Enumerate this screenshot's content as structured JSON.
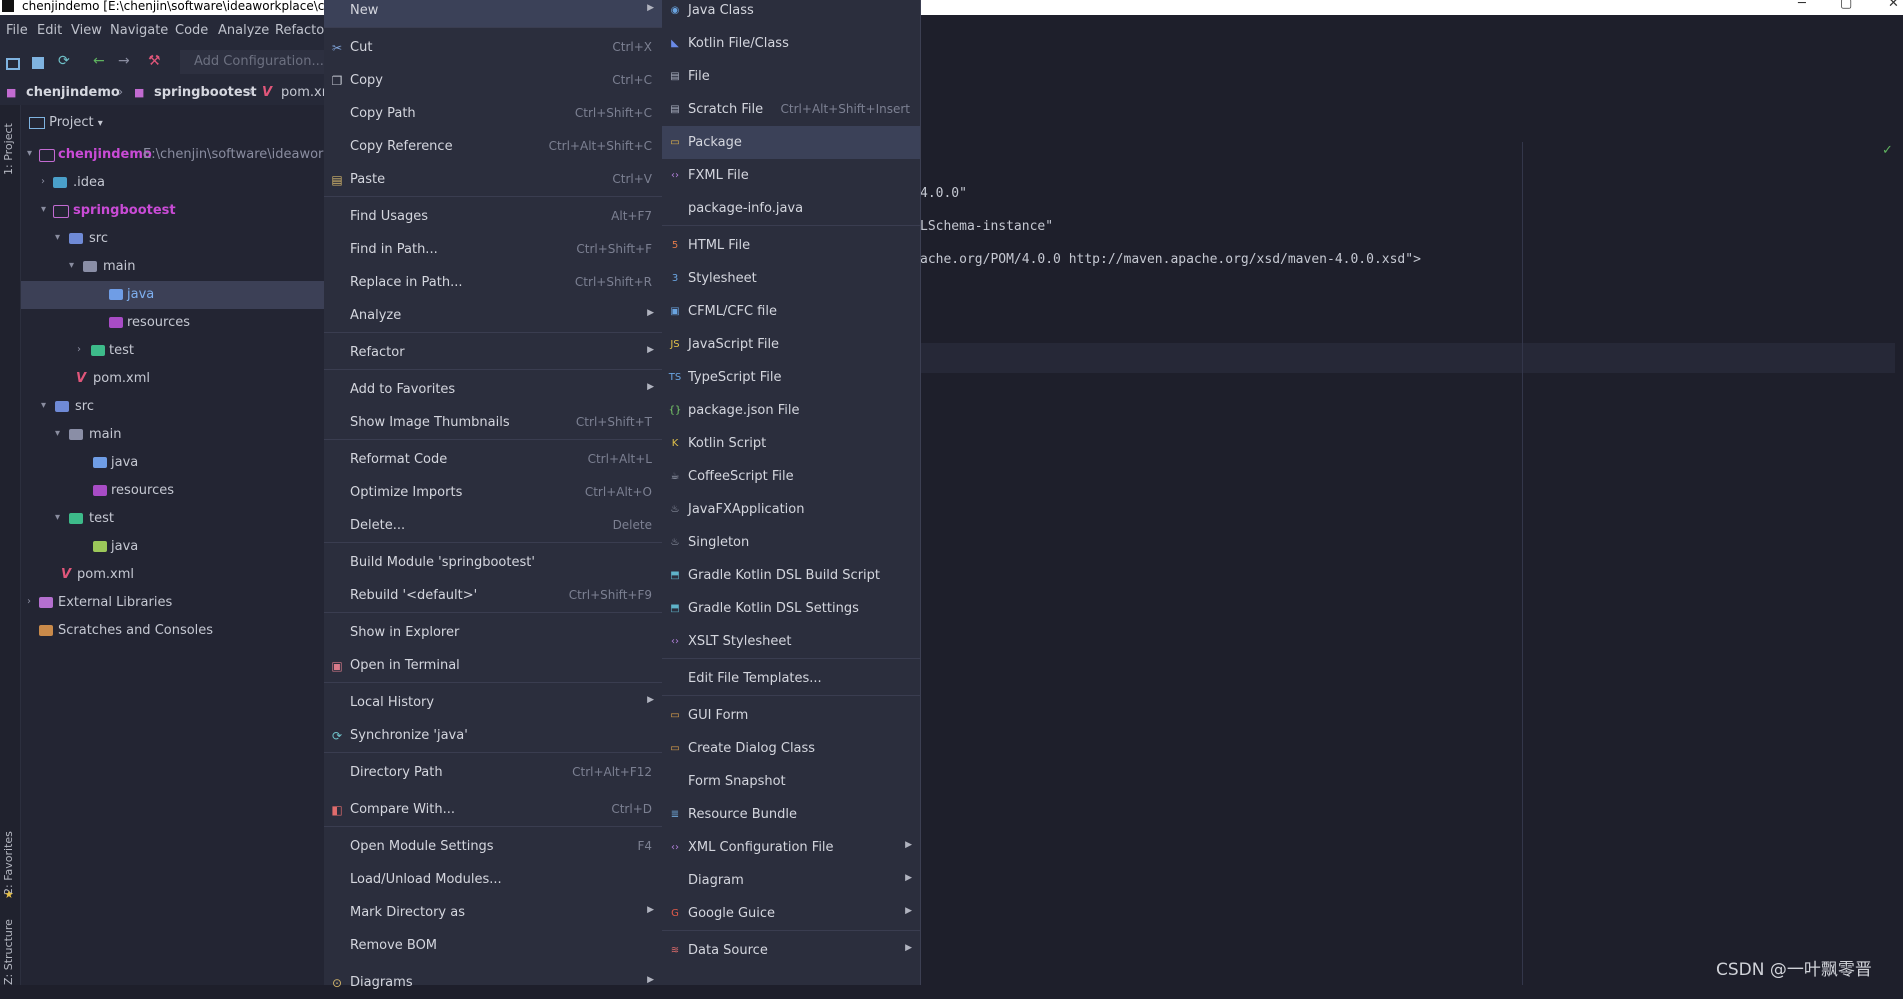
{
  "window": {
    "title": "chenjindemo [E:\\chenjin\\software\\ideaworkplace\\che"
  },
  "menubar": [
    "File",
    "Edit",
    "View",
    "Navigate",
    "Code",
    "Analyze",
    "Refactor"
  ],
  "toolbar": {
    "add_configuration": "Add Configuration..."
  },
  "breadcrumb": [
    "chenjindemo",
    "springbootest",
    "pom.xml"
  ],
  "left_strip": {
    "project_tab": "1: Project",
    "favorites_tab": "2: Favorites",
    "structure_tab": "Z: Structure"
  },
  "project_panel": {
    "header": "Project",
    "tree": [
      {
        "label": "chenjindemo",
        "path": "E:\\chenjin\\software\\ideaworkpl"
      },
      {
        "label": ".idea"
      },
      {
        "label": "springbootest"
      },
      {
        "label": "src"
      },
      {
        "label": "main"
      },
      {
        "label": "java"
      },
      {
        "label": "resources"
      },
      {
        "label": "test"
      },
      {
        "label": "pom.xml"
      },
      {
        "label": "src"
      },
      {
        "label": "main"
      },
      {
        "label": "java"
      },
      {
        "label": "resources"
      },
      {
        "label": "test"
      },
      {
        "label": "java"
      },
      {
        "label": "pom.xml"
      },
      {
        "label": "External Libraries"
      },
      {
        "label": "Scratches and Consoles"
      }
    ]
  },
  "editor": {
    "lines": [
      "4.0.0\"",
      "LSchema-instance\"",
      "ache.org/POM/4.0.0 http://maven.apache.org/xsd/maven-4.0.0.xsd\">"
    ]
  },
  "context_menu": [
    {
      "label": "New",
      "shortcut": "",
      "submenu": true
    },
    {
      "label": "Cut",
      "shortcut": "Ctrl+X"
    },
    {
      "label": "Copy",
      "shortcut": "Ctrl+C"
    },
    {
      "label": "Copy Path",
      "shortcut": "Ctrl+Shift+C"
    },
    {
      "label": "Copy Reference",
      "shortcut": "Ctrl+Alt+Shift+C"
    },
    {
      "label": "Paste",
      "shortcut": "Ctrl+V"
    },
    {
      "label": "Find Usages",
      "shortcut": "Alt+F7"
    },
    {
      "label": "Find in Path...",
      "shortcut": "Ctrl+Shift+F"
    },
    {
      "label": "Replace in Path...",
      "shortcut": "Ctrl+Shift+R"
    },
    {
      "label": "Analyze",
      "shortcut": "",
      "submenu": true
    },
    {
      "label": "Refactor",
      "shortcut": "",
      "submenu": true
    },
    {
      "label": "Add to Favorites",
      "shortcut": "",
      "submenu": true
    },
    {
      "label": "Show Image Thumbnails",
      "shortcut": "Ctrl+Shift+T"
    },
    {
      "label": "Reformat Code",
      "shortcut": "Ctrl+Alt+L"
    },
    {
      "label": "Optimize Imports",
      "shortcut": "Ctrl+Alt+O"
    },
    {
      "label": "Delete...",
      "shortcut": "Delete"
    },
    {
      "label": "Build Module 'springbootest'",
      "shortcut": ""
    },
    {
      "label": "Rebuild '<default>'",
      "shortcut": "Ctrl+Shift+F9"
    },
    {
      "label": "Show in Explorer",
      "shortcut": ""
    },
    {
      "label": "Open in Terminal",
      "shortcut": ""
    },
    {
      "label": "Local History",
      "shortcut": "",
      "submenu": true
    },
    {
      "label": "Synchronize 'java'",
      "shortcut": ""
    },
    {
      "label": "Directory Path",
      "shortcut": "Ctrl+Alt+F12"
    },
    {
      "label": "Compare With...",
      "shortcut": "Ctrl+D"
    },
    {
      "label": "Open Module Settings",
      "shortcut": "F4"
    },
    {
      "label": "Load/Unload Modules...",
      "shortcut": ""
    },
    {
      "label": "Mark Directory as",
      "shortcut": "",
      "submenu": true
    },
    {
      "label": "Remove BOM",
      "shortcut": ""
    },
    {
      "label": "Diagrams",
      "shortcut": "",
      "submenu": true
    }
  ],
  "new_submenu": [
    {
      "label": "Java Class",
      "shortcut": ""
    },
    {
      "label": "Kotlin File/Class",
      "shortcut": ""
    },
    {
      "label": "File",
      "shortcut": ""
    },
    {
      "label": "Scratch File",
      "shortcut": "Ctrl+Alt+Shift+Insert"
    },
    {
      "label": "Package",
      "shortcut": ""
    },
    {
      "label": "FXML File",
      "shortcut": ""
    },
    {
      "label": "package-info.java",
      "shortcut": ""
    },
    {
      "label": "HTML File",
      "shortcut": ""
    },
    {
      "label": "Stylesheet",
      "shortcut": ""
    },
    {
      "label": "CFML/CFC file",
      "shortcut": ""
    },
    {
      "label": "JavaScript File",
      "shortcut": ""
    },
    {
      "label": "TypeScript File",
      "shortcut": ""
    },
    {
      "label": "package.json File",
      "shortcut": ""
    },
    {
      "label": "Kotlin Script",
      "shortcut": ""
    },
    {
      "label": "CoffeeScript File",
      "shortcut": ""
    },
    {
      "label": "JavaFXApplication",
      "shortcut": ""
    },
    {
      "label": "Singleton",
      "shortcut": ""
    },
    {
      "label": "Gradle Kotlin DSL Build Script",
      "shortcut": ""
    },
    {
      "label": "Gradle Kotlin DSL Settings",
      "shortcut": ""
    },
    {
      "label": "XSLT Stylesheet",
      "shortcut": ""
    },
    {
      "label": "Edit File Templates...",
      "shortcut": ""
    },
    {
      "label": "GUI Form",
      "shortcut": ""
    },
    {
      "label": "Create Dialog Class",
      "shortcut": ""
    },
    {
      "label": "Form Snapshot",
      "shortcut": ""
    },
    {
      "label": "Resource Bundle",
      "shortcut": ""
    },
    {
      "label": "XML Configuration File",
      "shortcut": "",
      "submenu": true
    },
    {
      "label": "Diagram",
      "shortcut": "",
      "submenu": true
    },
    {
      "label": "Google Guice",
      "shortcut": "",
      "submenu": true
    },
    {
      "label": "Data Source",
      "shortcut": "",
      "submenu": true
    }
  ],
  "watermark": "CSDN @一叶飘零晋"
}
